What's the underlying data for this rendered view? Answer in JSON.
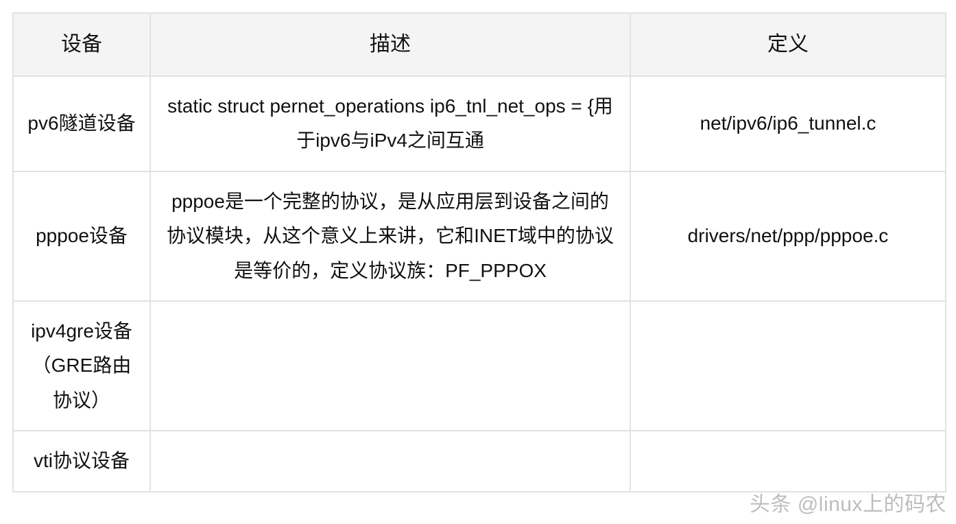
{
  "headers": [
    "设备",
    "描述",
    "定义"
  ],
  "rows": [
    {
      "device": "pv6隧道设备",
      "description": "static struct pernet_operations ip6_tnl_net_ops = {用于ipv6与iPv4之间互通",
      "definition": "net/ipv6/ip6_tunnel.c"
    },
    {
      "device": "pppoe设备",
      "description": "pppoe是一个完整的协议，是从应用层到设备之间的协议模块，从这个意义上来讲，它和INET域中的协议是等价的，定义协议族：PF_PPPOX",
      "definition": "drivers/net/ppp/pppoe.c"
    },
    {
      "device": "ipv4gre设备（GRE路由协议）",
      "description": "",
      "definition": ""
    },
    {
      "device": "vti协议设备",
      "description": "",
      "definition": ""
    }
  ],
  "watermark": "头条 @linux上的码农"
}
